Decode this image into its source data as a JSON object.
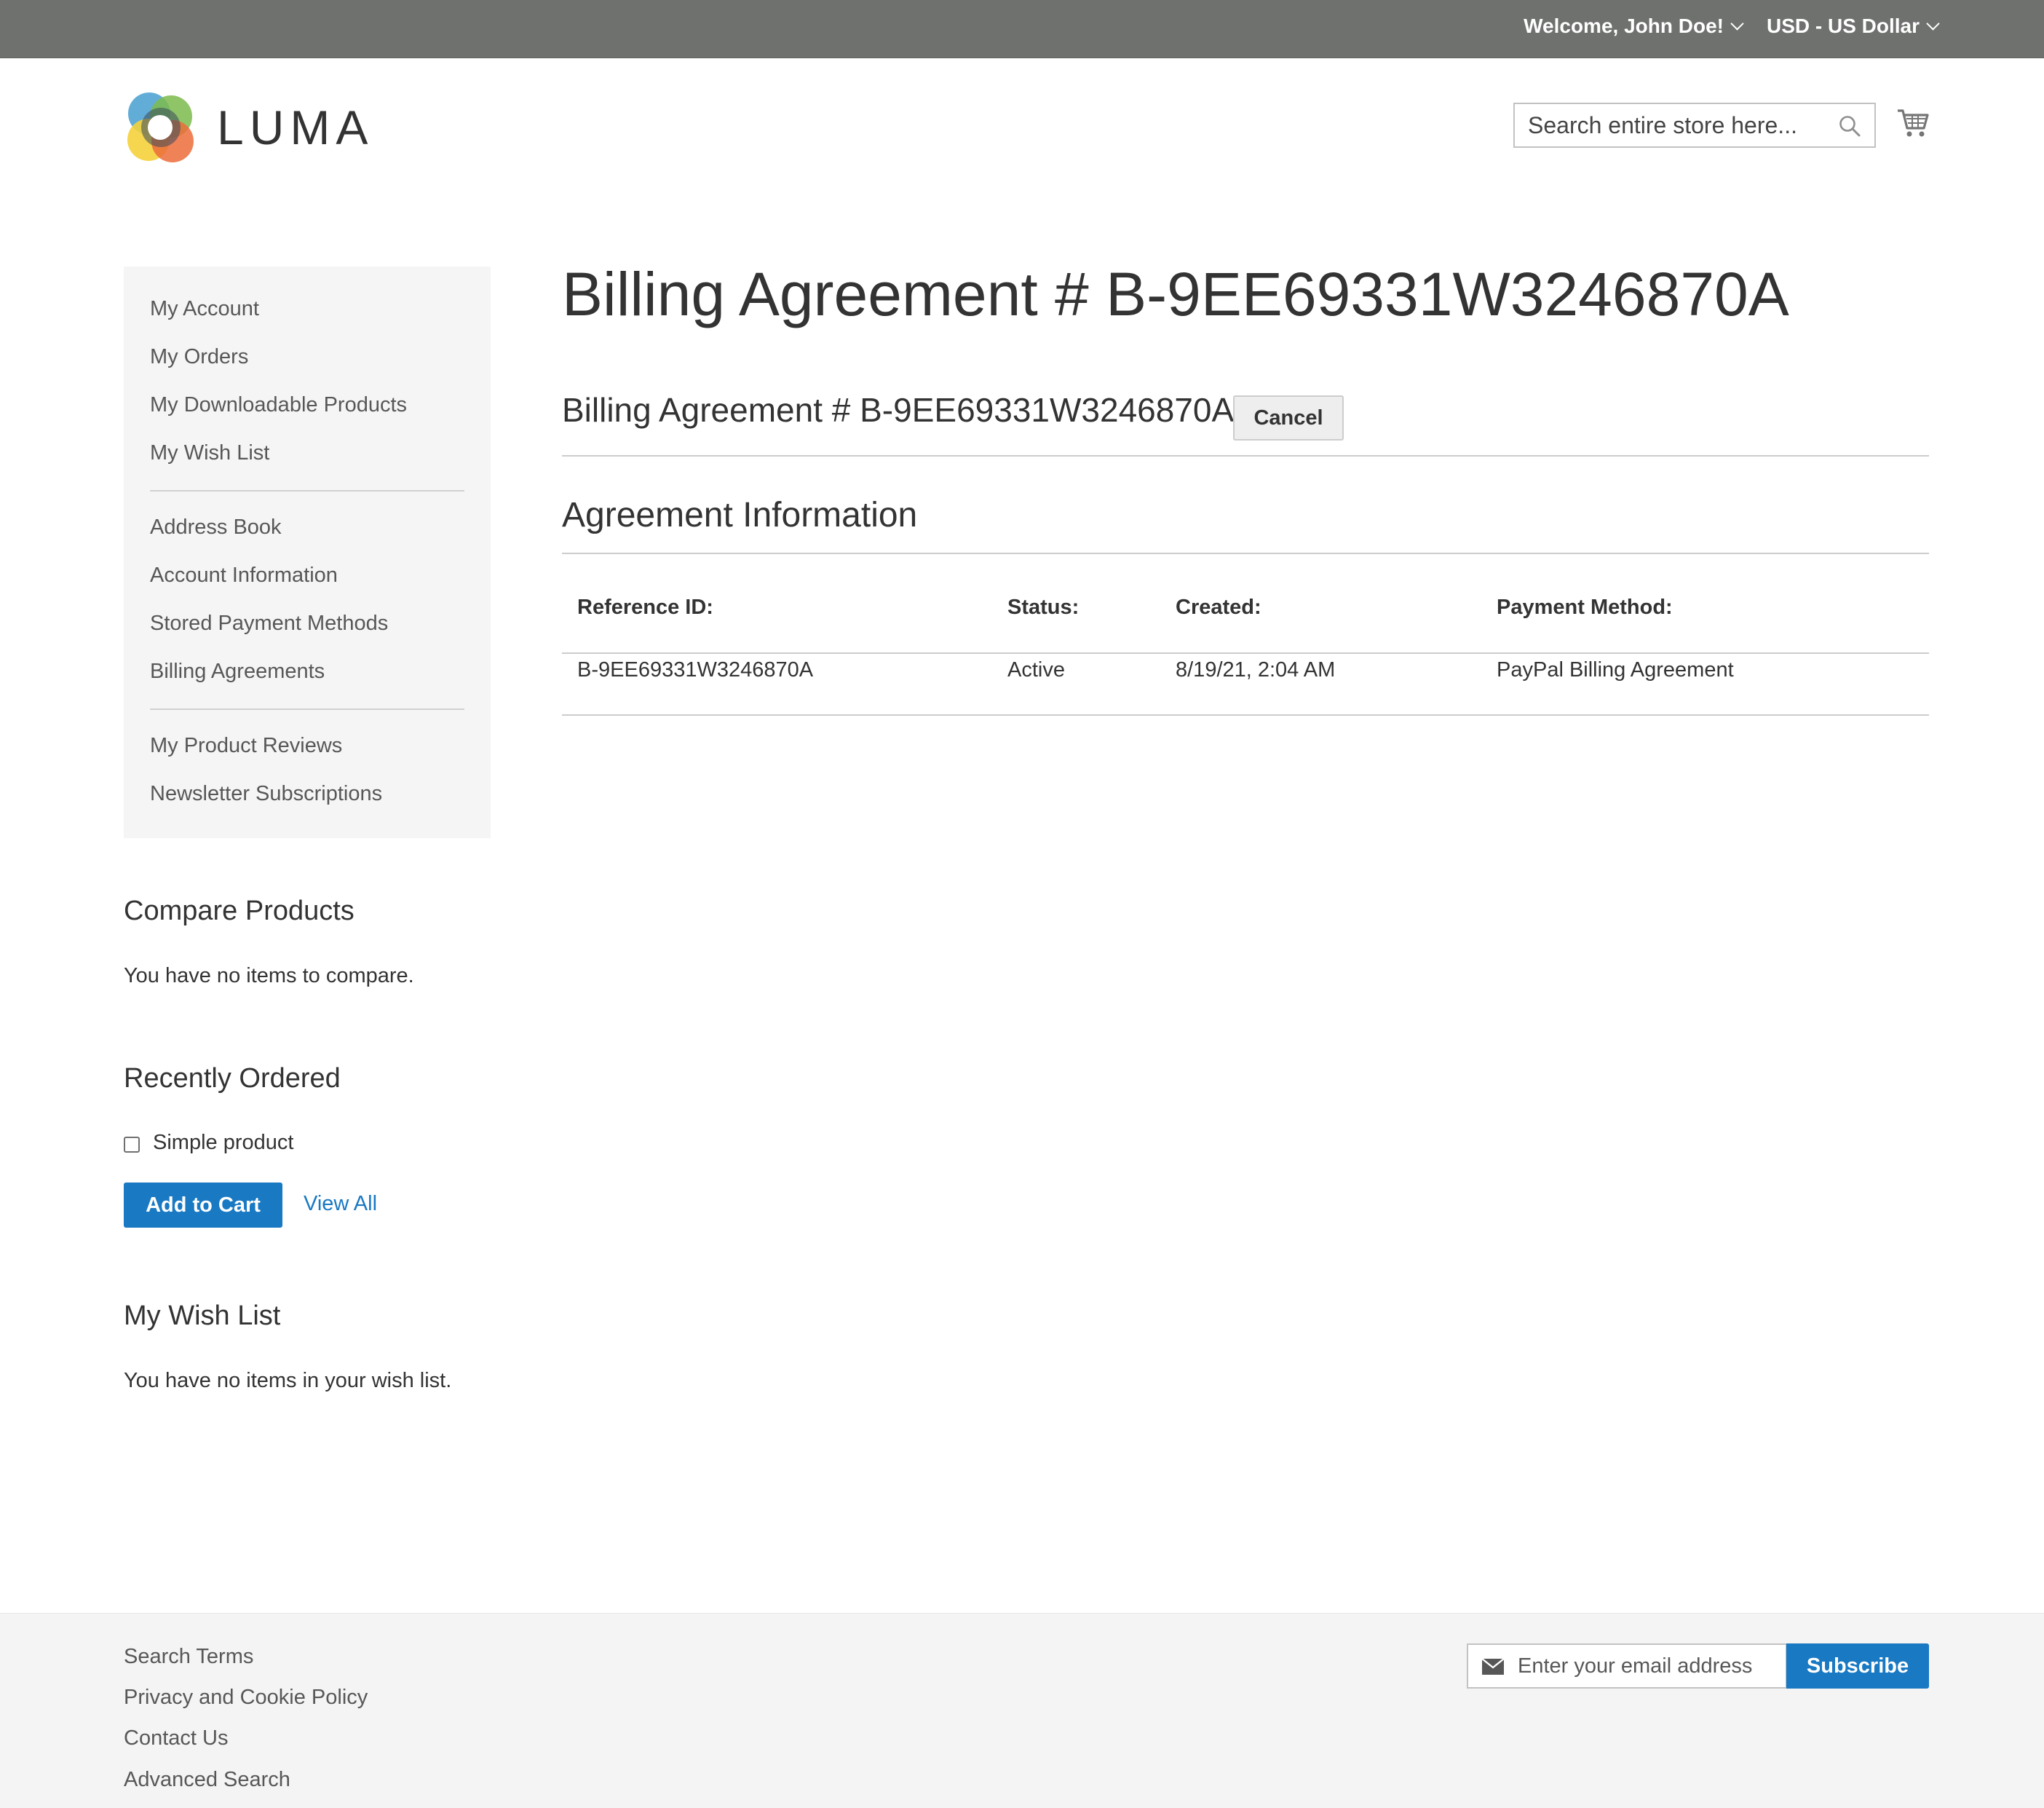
{
  "header": {
    "welcome": "Welcome, John Doe!",
    "currency": "USD - US Dollar",
    "logo_text": "LUMA",
    "search_placeholder": "Search entire store here...",
    "icons": {
      "search": "search-icon",
      "cart": "cart-icon",
      "chevron": "chevron-down-icon"
    }
  },
  "sidebar": {
    "nav": [
      {
        "label": "My Account"
      },
      {
        "label": "My Orders"
      },
      {
        "label": "My Downloadable Products"
      },
      {
        "label": "My Wish List"
      },
      {
        "label": "Address Book"
      },
      {
        "label": "Account Information"
      },
      {
        "label": "Stored Payment Methods"
      },
      {
        "label": "Billing Agreements"
      },
      {
        "label": "My Product Reviews"
      },
      {
        "label": "Newsletter Subscriptions"
      }
    ],
    "compare": {
      "title": "Compare Products",
      "empty": "You have no items to compare."
    },
    "recently_ordered": {
      "title": "Recently Ordered",
      "items": [
        {
          "label": "Simple product",
          "checked": false
        }
      ],
      "add_to_cart": "Add to Cart",
      "view_all": "View All"
    },
    "wishlist": {
      "title": "My Wish List",
      "empty": "You have no items in your wish list."
    }
  },
  "main": {
    "page_title": "Billing Agreement # B-9EE69331W3246870A",
    "sub_title": "Billing Agreement # B-9EE69331W3246870A",
    "cancel_label": "Cancel",
    "section_title": "Agreement Information",
    "table": {
      "headers": [
        "Reference ID:",
        "Status:",
        "Created:",
        "Payment Method:"
      ],
      "rows": [
        [
          "B-9EE69331W3246870A",
          "Active",
          "8/19/21, 2:04 AM",
          "PayPal Billing Agreement"
        ]
      ]
    }
  },
  "footer": {
    "links": [
      "Search Terms",
      "Privacy and Cookie Policy",
      "Contact Us",
      "Advanced Search"
    ],
    "newsletter_placeholder": "Enter your email address",
    "subscribe_label": "Subscribe"
  },
  "colors": {
    "top_panel": "#6e716e",
    "primary_button": "#1979c3",
    "sidebar_bg": "#f5f5f5",
    "footer_bg": "#f4f4f4"
  }
}
